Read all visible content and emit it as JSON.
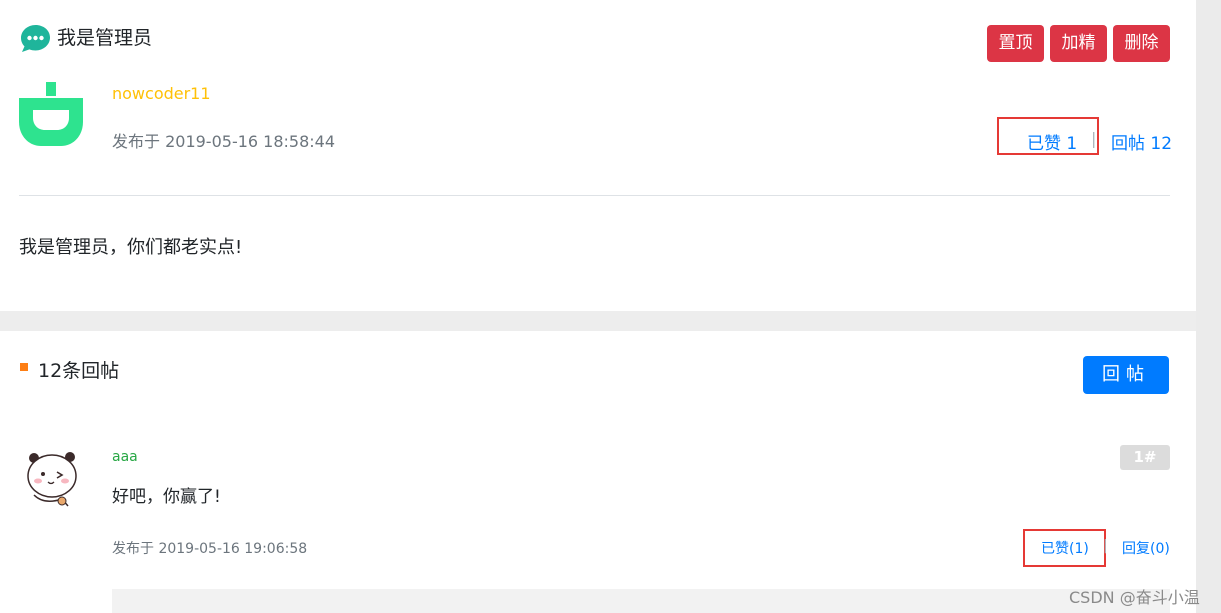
{
  "post": {
    "title": "我是管理员",
    "actions": {
      "top": "置顶",
      "fine": "加精",
      "delete": "删除"
    },
    "author": "nowcoder11",
    "time": "发布于 2019-05-16 18:58:44",
    "like": "已赞 1",
    "separator": "|",
    "reply": "回帖 12",
    "content": "我是管理员，你们都老实点!"
  },
  "replies": {
    "count_label": "12条回帖",
    "reply_button": "回帖",
    "items": [
      {
        "user": "aaa",
        "text": "好吧，你赢了!",
        "floor": "1#",
        "time": "发布于 2019-05-16 19:06:58",
        "like": "已赞(1)",
        "separator": "|",
        "reply": "回复(0)"
      }
    ]
  },
  "watermark": "CSDN @奋斗小温",
  "colors": {
    "danger": "#dc3545",
    "primary": "#007bff",
    "warning": "#ffc107",
    "success": "#28a745",
    "accent": "#fd7e14",
    "icon_teal": "#1fb59b",
    "avatar_green": "#2ee38f"
  },
  "icons": [
    "chat-bubble-icon",
    "plug-avatar-icon",
    "panda-avatar-icon"
  ]
}
